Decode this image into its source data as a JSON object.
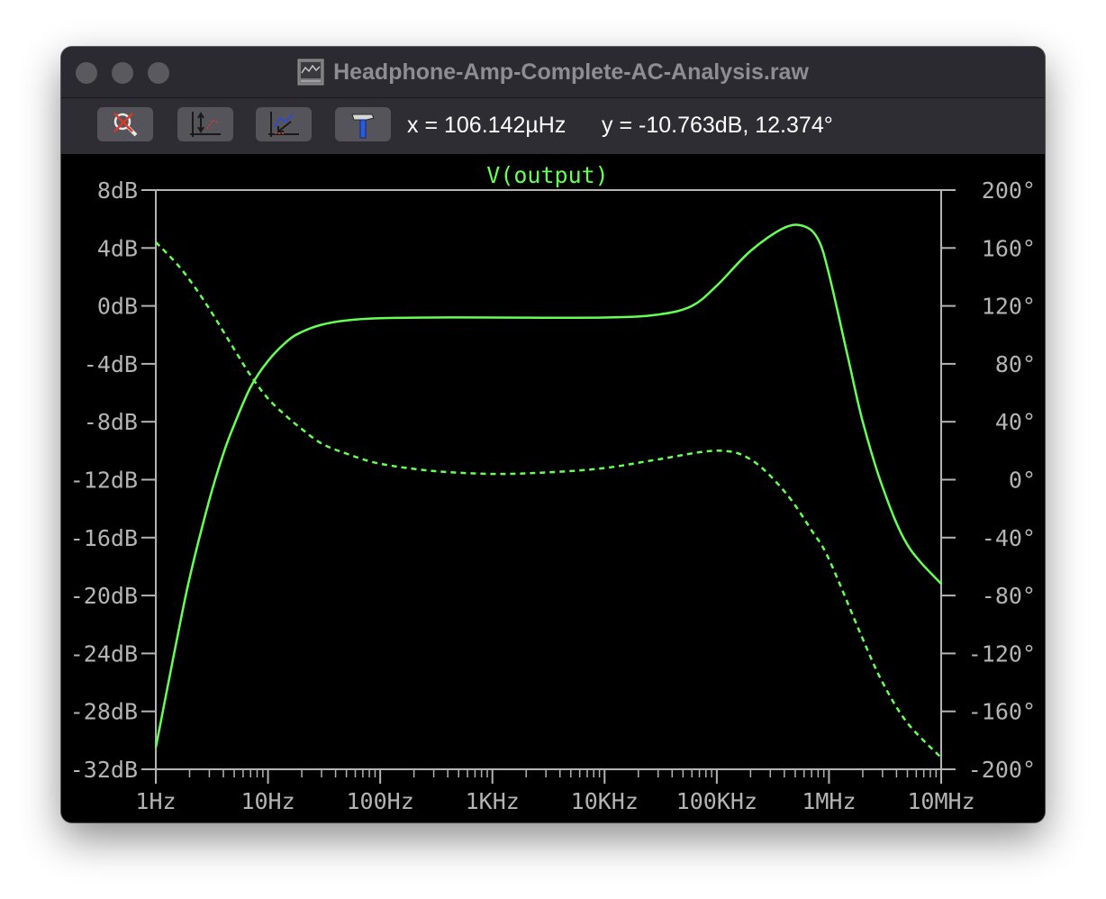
{
  "window": {
    "title": "Headphone-Amp-Complete-AC-Analysis.raw",
    "traffic_lights": [
      "close",
      "minimize",
      "zoom"
    ],
    "file_icon": "waveform-file-icon"
  },
  "toolbar": {
    "buttons": [
      {
        "name": "zoom-cancel-icon"
      },
      {
        "name": "autorange-icon"
      },
      {
        "name": "zoom-back-icon"
      },
      {
        "name": "hammer-icon"
      }
    ],
    "cursor_x": "x = 106.142µHz",
    "cursor_y": "y = -10.763dB, 12.374°"
  },
  "colors": {
    "trace": "#66ff55",
    "axis": "#b4b4b4",
    "background": "#000000"
  },
  "chart_data": {
    "type": "line",
    "title": "V(output)",
    "x_scale": "log",
    "xlim": [
      1,
      10000000
    ],
    "x_tick_labels": [
      "1Hz",
      "10Hz",
      "100Hz",
      "1KHz",
      "10KHz",
      "100KHz",
      "1MHz",
      "10MHz"
    ],
    "x_tick_values": [
      1,
      10,
      100,
      1000,
      10000,
      100000,
      1000000,
      10000000
    ],
    "ylim": [
      -32,
      8
    ],
    "y_tick_labels": [
      "8dB",
      "4dB",
      "0dB",
      "-4dB",
      "-8dB",
      "-12dB",
      "-16dB",
      "-20dB",
      "-24dB",
      "-28dB",
      "-32dB"
    ],
    "y_tick_values": [
      8,
      4,
      0,
      -4,
      -8,
      -12,
      -16,
      -20,
      -24,
      -28,
      -32
    ],
    "y2lim": [
      -200,
      200
    ],
    "y2_tick_labels": [
      "200°",
      "160°",
      "120°",
      "80°",
      "40°",
      "0°",
      "-40°",
      "-80°",
      "-120°",
      "-160°",
      "-200°"
    ],
    "y2_tick_values": [
      200,
      160,
      120,
      80,
      40,
      0,
      -40,
      -80,
      -120,
      -160,
      -200
    ],
    "grid": false,
    "series": [
      {
        "name": "V(output)",
        "quantity": "magnitude",
        "axis": "left",
        "style": "solid",
        "x": [
          1,
          1.5,
          2,
          3,
          4,
          5,
          7,
          10,
          15,
          20,
          30,
          50,
          100,
          300,
          1000,
          10000,
          30000,
          60000,
          100000,
          200000,
          400000,
          600000,
          800000,
          1000000,
          1500000,
          2000000,
          3000000,
          5000000,
          10000000
        ],
        "y": [
          -30.5,
          -23.5,
          -18.8,
          -13.4,
          -10.2,
          -8.2,
          -5.6,
          -3.8,
          -2.4,
          -1.8,
          -1.3,
          -1.0,
          -0.85,
          -0.8,
          -0.8,
          -0.8,
          -0.6,
          0.0,
          1.4,
          3.8,
          5.4,
          5.5,
          4.6,
          2.2,
          -3.8,
          -8.0,
          -12.5,
          -16.5,
          -19.2
        ]
      },
      {
        "name": "V(output)",
        "quantity": "phase",
        "axis": "right",
        "style": "dashed",
        "x": [
          1,
          1.5,
          2,
          3,
          5,
          7,
          10,
          15,
          20,
          30,
          50,
          100,
          300,
          1000,
          3000,
          10000,
          30000,
          100000,
          200000,
          400000,
          700000,
          1000000,
          2000000,
          3000000,
          5000000,
          10000000
        ],
        "y": [
          164,
          150,
          138,
          118,
          90,
          72,
          56,
          43,
          35,
          25,
          18,
          11,
          6,
          4,
          5,
          8,
          14,
          20,
          14,
          -8,
          -35,
          -55,
          -110,
          -140,
          -168,
          -192
        ]
      }
    ]
  }
}
